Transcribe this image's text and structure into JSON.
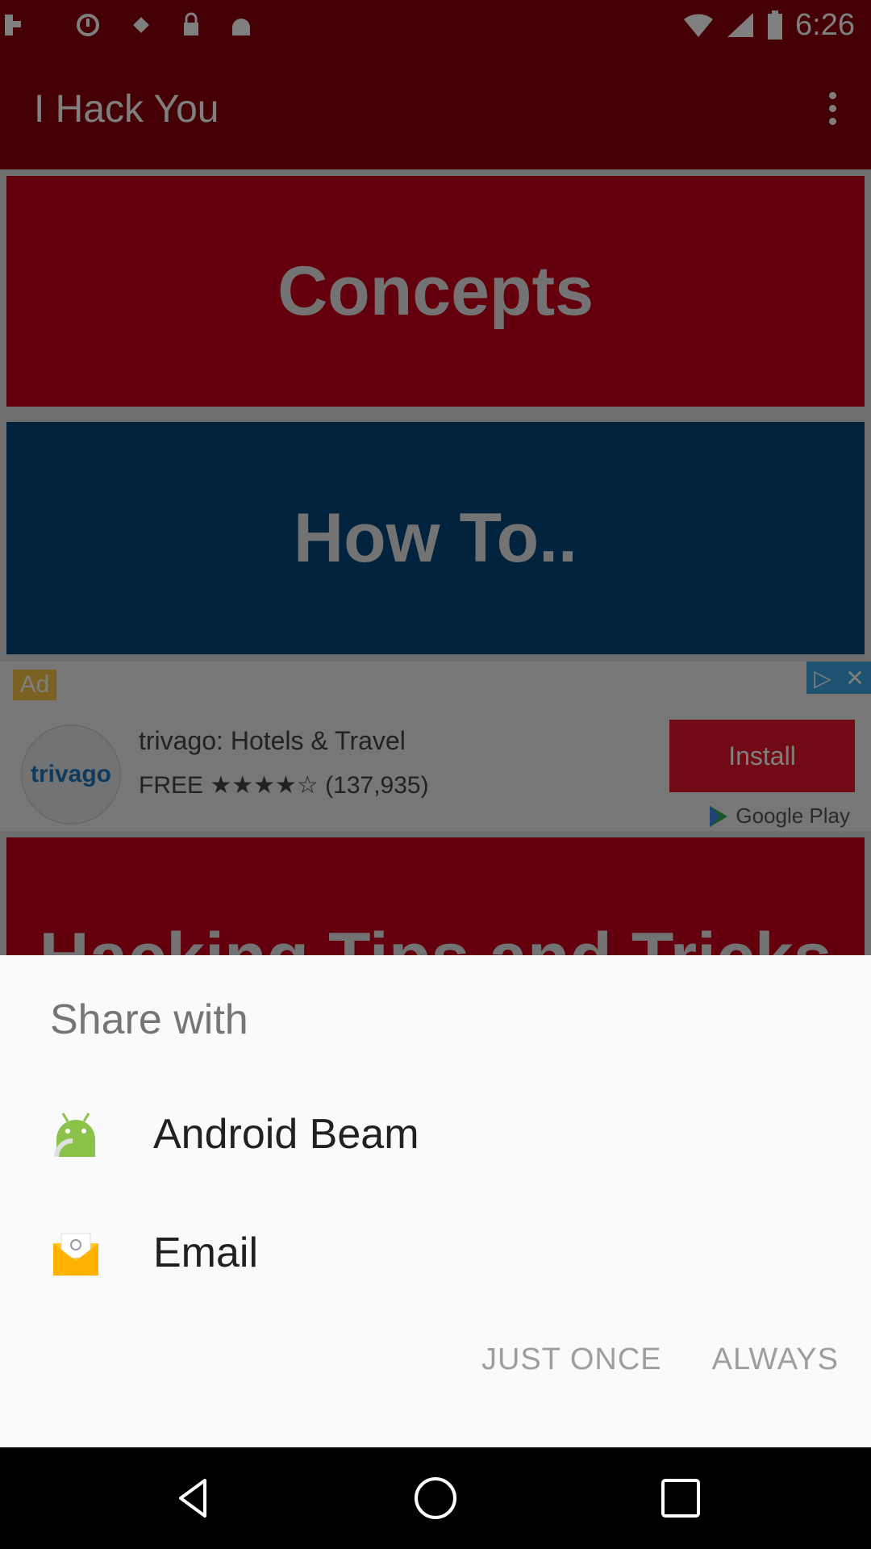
{
  "status_bar": {
    "time": "6:26",
    "icons": [
      "usb-debug-icon",
      "sync-icon",
      "fake-gps-icon",
      "lock-icon",
      "android-icon",
      "wifi-icon",
      "signal-icon",
      "battery-icon"
    ]
  },
  "app_bar": {
    "title": "I Hack You",
    "menu_icon": "overflow-menu-icon"
  },
  "tiles": {
    "concepts": "Concepts",
    "how_to": "How To..",
    "hacking": "Hacking Tips and Tricks"
  },
  "ad": {
    "badge": "Ad",
    "app_name": "trivago: Hotels & Travel",
    "price_rating": "FREE ★★★★☆ (137,935)",
    "logo_text": "trivago",
    "install_label": "Install",
    "store_label": "Google Play"
  },
  "share_sheet": {
    "title": "Share with",
    "items": [
      {
        "label": "Android Beam",
        "icon": "android-beam-icon"
      },
      {
        "label": "Email",
        "icon": "email-icon"
      }
    ],
    "just_once_label": "JUST ONCE",
    "always_label": "ALWAYS"
  },
  "colors": {
    "brand_red": "#c8001a",
    "tile_blue": "#02477c",
    "appbar_red": "#8a000a"
  }
}
